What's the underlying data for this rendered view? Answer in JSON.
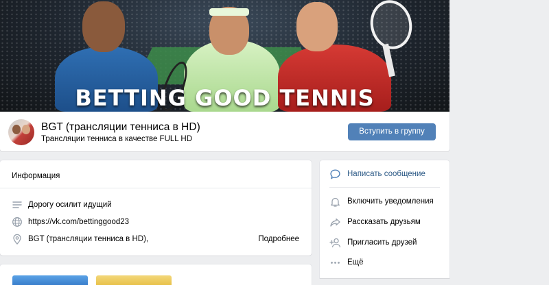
{
  "cover": {
    "title": "BETTING GOOD TENNIS"
  },
  "group": {
    "name": "BGT (трансляции тенниса в HD)",
    "status": "Трансляции тенниса в качестве FULL HD",
    "join_label": "Вступить в группу"
  },
  "info": {
    "title": "Информация",
    "description": "Дорогу осилит идущий",
    "link": "https://vk.com/bettinggood23",
    "location": "BGT (трансляции тенниса в HD),",
    "more_label": "Подробнее"
  },
  "actions": {
    "message": "Написать сообщение",
    "notify": "Включить уведомления",
    "share": "Рассказать друзьям",
    "invite": "Пригласить друзей",
    "more": "Ещё"
  },
  "colors": {
    "accent": "#5181b8",
    "link": "#2a5885",
    "background": "#edeef0"
  }
}
